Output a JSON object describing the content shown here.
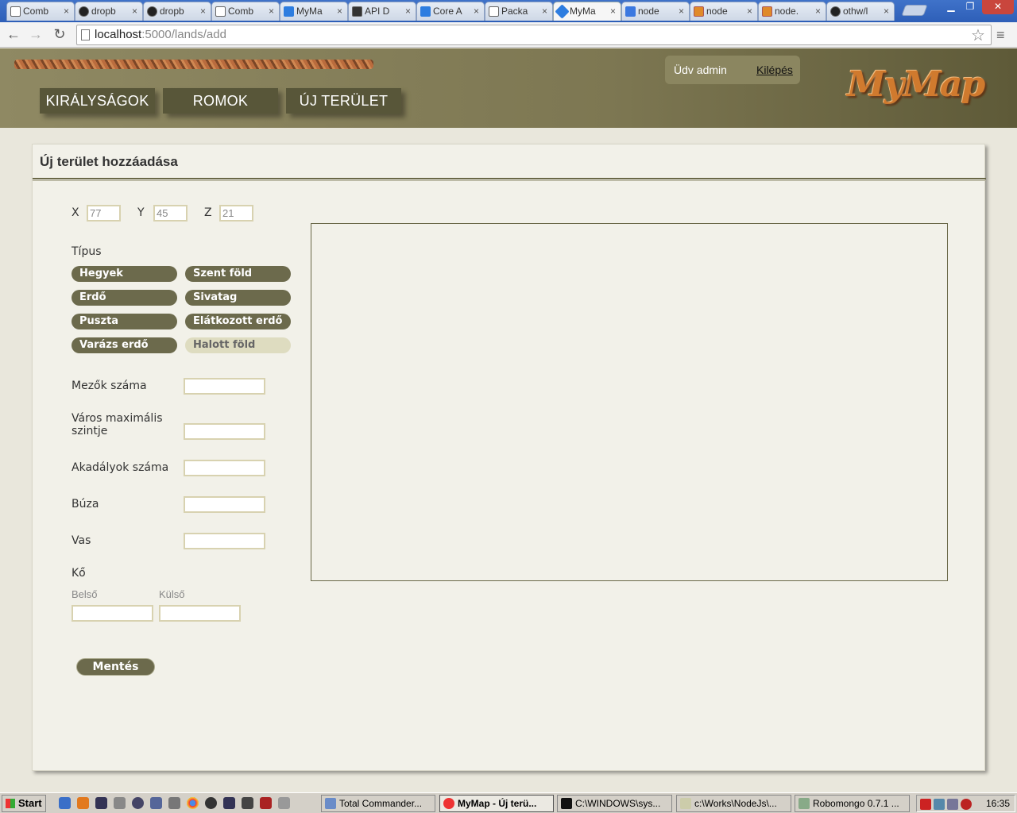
{
  "browser": {
    "tabs": [
      {
        "label": "Comb"
      },
      {
        "label": "dropb"
      },
      {
        "label": "dropb"
      },
      {
        "label": "Comb"
      },
      {
        "label": "MyMa"
      },
      {
        "label": "API D"
      },
      {
        "label": "Core A"
      },
      {
        "label": "Packa"
      },
      {
        "label": "MyMa"
      },
      {
        "label": "node"
      },
      {
        "label": "node"
      },
      {
        "label": "node."
      },
      {
        "label": "othw/l"
      }
    ],
    "url_host": "localhost",
    "url_rest": ":5000/lands/add",
    "close_glyph": "×"
  },
  "header": {
    "nav": [
      "KIRÁLYSÁGOK",
      "ROMOK",
      "ÚJ TERÜLET"
    ],
    "welcome": "Üdv admin",
    "logout": "Kilépés",
    "logo": "MyMap"
  },
  "form": {
    "title": "Új terület hozzáadása",
    "coords": {
      "x_label": "X",
      "x_value": "77",
      "y_label": "Y",
      "y_value": "45",
      "z_label": "Z",
      "z_value": "21"
    },
    "type_label": "Típus",
    "types": [
      {
        "label": "Hegyek",
        "selected": false
      },
      {
        "label": "Szent föld",
        "selected": false
      },
      {
        "label": "Erdő",
        "selected": false
      },
      {
        "label": "Sivatag",
        "selected": false
      },
      {
        "label": "Puszta",
        "selected": false
      },
      {
        "label": "Elátkozott erdő",
        "selected": false
      },
      {
        "label": "Varázs erdő",
        "selected": false
      },
      {
        "label": "Halott föld",
        "selected": true
      }
    ],
    "fields": [
      {
        "label": "Mezők száma"
      },
      {
        "label": "Város maximális szintje"
      },
      {
        "label": "Akadályok száma"
      },
      {
        "label": "Búza"
      },
      {
        "label": "Vas"
      }
    ],
    "stone_label": "Kő",
    "inner_label": "Belső",
    "outer_label": "Külső",
    "save": "Mentés"
  },
  "taskbar": {
    "start": "Start",
    "tasks": [
      {
        "label": "Total Commander..."
      },
      {
        "label": "MyMap - Új terü..."
      },
      {
        "label": "C:\\WINDOWS\\sys..."
      },
      {
        "label": "c:\\Works\\NodeJs\\..."
      },
      {
        "label": "Robomongo 0.7.1 ..."
      }
    ],
    "clock": "16:35"
  },
  "colors": {
    "header_olive": "#7d7752",
    "nav_dark": "#585639",
    "button_olive": "#6c6a4c",
    "selected_type": "#dedcc0",
    "panel_bg": "#f2f1e9",
    "logo_orange": "#d07a2e"
  }
}
